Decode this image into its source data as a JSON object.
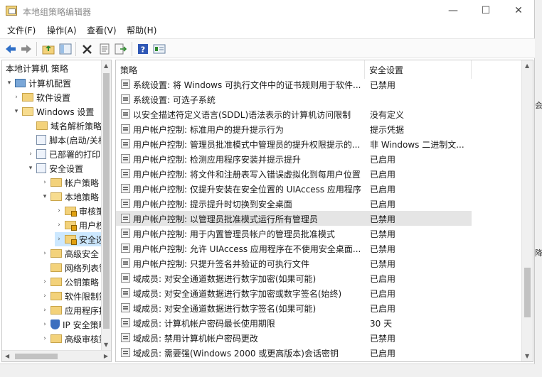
{
  "window": {
    "title": "本地组策略编辑器",
    "minimize_glyph": "—",
    "maximize_glyph": "☐",
    "close_glyph": "✕"
  },
  "menu": [
    "文件(F)",
    "操作(A)",
    "查看(V)",
    "帮助(H)"
  ],
  "toolbar": {
    "icons": [
      "back-arrow-icon",
      "forward-arrow-icon",
      "up-folder-icon",
      "show-hide-tree-icon",
      "delete-icon",
      "properties-icon",
      "export-list-icon",
      "help-icon",
      "view-icon"
    ]
  },
  "tree": {
    "header": "本地计算机 策略",
    "nodes": [
      {
        "label": "计算机配置",
        "icon": "computer-icon",
        "arrow": "▾",
        "selected": false
      },
      {
        "label": "软件设置",
        "icon": "folder-icon",
        "arrow": "›",
        "selected": false
      },
      {
        "label": "Windows 设置",
        "icon": "folder-icon",
        "arrow": "▾",
        "selected": false
      },
      {
        "label": "域名解析策略",
        "icon": "folder-icon",
        "arrow": "",
        "selected": false
      },
      {
        "label": "脚本(启动/关机",
        "icon": "document-icon",
        "arrow": "",
        "selected": false
      },
      {
        "label": "已部署的打印",
        "icon": "printer-icon",
        "arrow": "›",
        "selected": false
      },
      {
        "label": "安全设置",
        "icon": "security-icon",
        "arrow": "▾",
        "selected": false
      },
      {
        "label": "帐户策略",
        "icon": "folder-icon",
        "arrow": "›",
        "selected": false
      },
      {
        "label": "本地策略",
        "icon": "folder-icon",
        "arrow": "▾",
        "selected": false
      },
      {
        "label": "审核策",
        "icon": "folder-icon",
        "arrow": "›",
        "selected": false
      },
      {
        "label": "用户权",
        "icon": "folder-icon",
        "arrow": "›",
        "selected": false
      },
      {
        "label": "安全选",
        "icon": "folder-icon",
        "arrow": "›",
        "selected": true
      },
      {
        "label": "高级安全 W",
        "icon": "folder-icon",
        "arrow": "›",
        "selected": false
      },
      {
        "label": "网络列表管",
        "icon": "folder-icon",
        "arrow": "",
        "selected": false
      },
      {
        "label": "公钥策略",
        "icon": "folder-icon",
        "arrow": "›",
        "selected": false
      },
      {
        "label": "软件限制策",
        "icon": "folder-icon",
        "arrow": "›",
        "selected": false
      },
      {
        "label": "应用程序控",
        "icon": "folder-icon",
        "arrow": "›",
        "selected": false
      },
      {
        "label": "IP 安全策略",
        "icon": "ip-security-icon",
        "arrow": "›",
        "selected": false
      },
      {
        "label": "高级审核策",
        "icon": "folder-icon",
        "arrow": "›",
        "selected": false
      }
    ]
  },
  "list": {
    "columns": [
      "策略",
      "安全设置"
    ],
    "sort_caret": "⌃",
    "rows": [
      {
        "name": "系统设置: 将 Windows 可执行文件中的证书规则用于软件...",
        "value": "已禁用"
      },
      {
        "name": "系统设置: 可选子系统",
        "value": ""
      },
      {
        "name": "以安全描述符定义语言(SDDL)语法表示的计算机访问限制",
        "value": "没有定义"
      },
      {
        "name": "用户帐户控制: 标准用户的提升提示行为",
        "value": "提示凭据"
      },
      {
        "name": "用户帐户控制: 管理员批准模式中管理员的提升权限提示的...",
        "value": "非 Windows 二进制文..."
      },
      {
        "name": "用户帐户控制: 检测应用程序安装并提示提升",
        "value": "已启用"
      },
      {
        "name": "用户帐户控制: 将文件和注册表写入错误虚拟化到每用户位置",
        "value": "已启用"
      },
      {
        "name": "用户帐户控制: 仅提升安装在安全位置的 UIAccess 应用程序",
        "value": "已启用"
      },
      {
        "name": "用户帐户控制: 提示提升时切换到安全桌面",
        "value": "已启用"
      },
      {
        "name": "用户帐户控制: 以管理员批准模式运行所有管理员",
        "value": "已禁用"
      },
      {
        "name": "用户帐户控制: 用于内置管理员帐户的管理员批准模式",
        "value": "已禁用"
      },
      {
        "name": "用户帐户控制: 允许 UIAccess 应用程序在不使用安全桌面...",
        "value": "已禁用"
      },
      {
        "name": "用户帐户控制: 只提升签名并验证的可执行文件",
        "value": "已禁用"
      },
      {
        "name": "域成员: 对安全通道数据进行数字加密(如果可能)",
        "value": "已启用"
      },
      {
        "name": "域成员: 对安全通道数据进行数字加密或数字签名(始终)",
        "value": "已启用"
      },
      {
        "name": "域成员: 对安全通道数据进行数字签名(如果可能)",
        "value": "已启用"
      },
      {
        "name": "域成员: 计算机帐户密码最长使用期限",
        "value": "30 天"
      },
      {
        "name": "域成员: 禁用计算机帐户密码更改",
        "value": "已禁用"
      },
      {
        "name": "域成员: 需要强(Windows 2000 或更高版本)会话密钥",
        "value": "已启用"
      }
    ],
    "highlighted_row": 9
  },
  "background_window": {
    "fragments": [
      "会",
      "降"
    ]
  }
}
